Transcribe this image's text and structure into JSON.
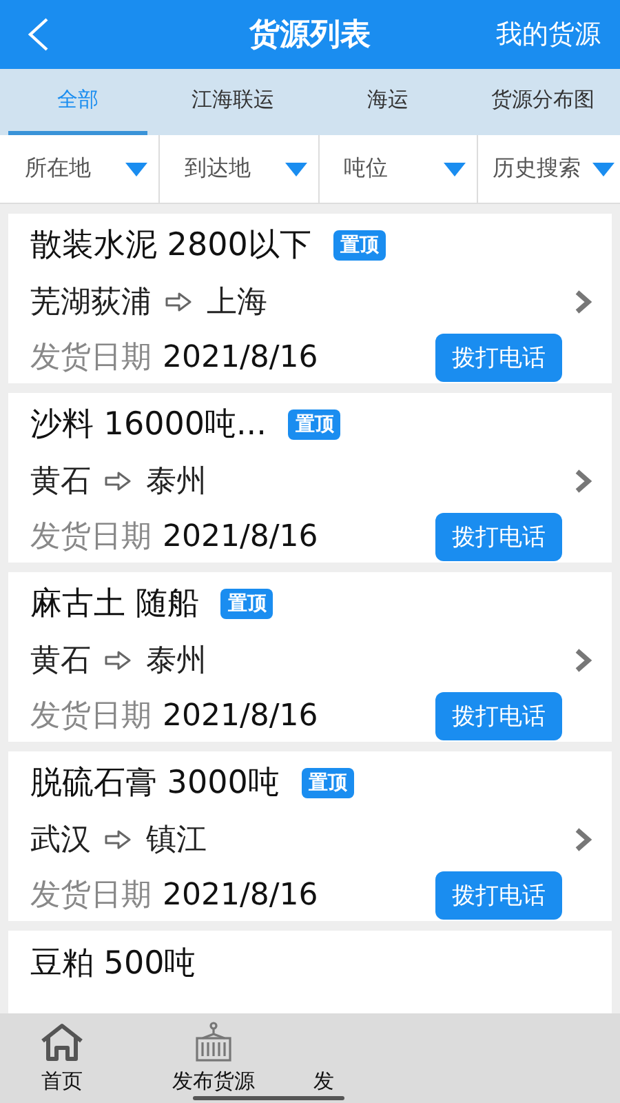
{
  "header": {
    "title": "货源列表",
    "action": "我的货源"
  },
  "tabs": [
    {
      "label": "全部",
      "selected": true
    },
    {
      "label": "江海联运",
      "selected": false
    },
    {
      "label": "海运",
      "selected": false
    },
    {
      "label": "货源分布图",
      "selected": false
    }
  ],
  "filters": [
    "所在地",
    "到达地",
    "吨位",
    "历史搜索"
  ],
  "cargo": [
    {
      "title": "散装水泥 2800以下",
      "pin": "置顶",
      "from": "芜湖荻浦",
      "to": "上海",
      "date_label": "发货日期",
      "date": "2021/8/16",
      "call": "拨打电话"
    },
    {
      "title": "沙料 16000吨...",
      "pin": "置顶",
      "from": "黄石",
      "to": "泰州",
      "date_label": "发货日期",
      "date": "2021/8/16",
      "call": "拨打电话"
    },
    {
      "title": "麻古土 随船",
      "pin": "置顶",
      "from": "黄石",
      "to": "泰州",
      "date_label": "发货日期",
      "date": "2021/8/16",
      "call": "拨打电话"
    },
    {
      "title": "脱硫石膏 3000吨",
      "pin": "置顶",
      "from": "武汉",
      "to": "镇江",
      "date_label": "发货日期",
      "date": "2021/8/16",
      "call": "拨打电话"
    },
    {
      "title": "豆粕 500吨"
    }
  ],
  "bottom_nav": [
    {
      "label": "首页",
      "kind": "home"
    },
    {
      "label": "发布货源",
      "kind": "publish"
    },
    {
      "label": "发",
      "kind": "covered"
    }
  ]
}
